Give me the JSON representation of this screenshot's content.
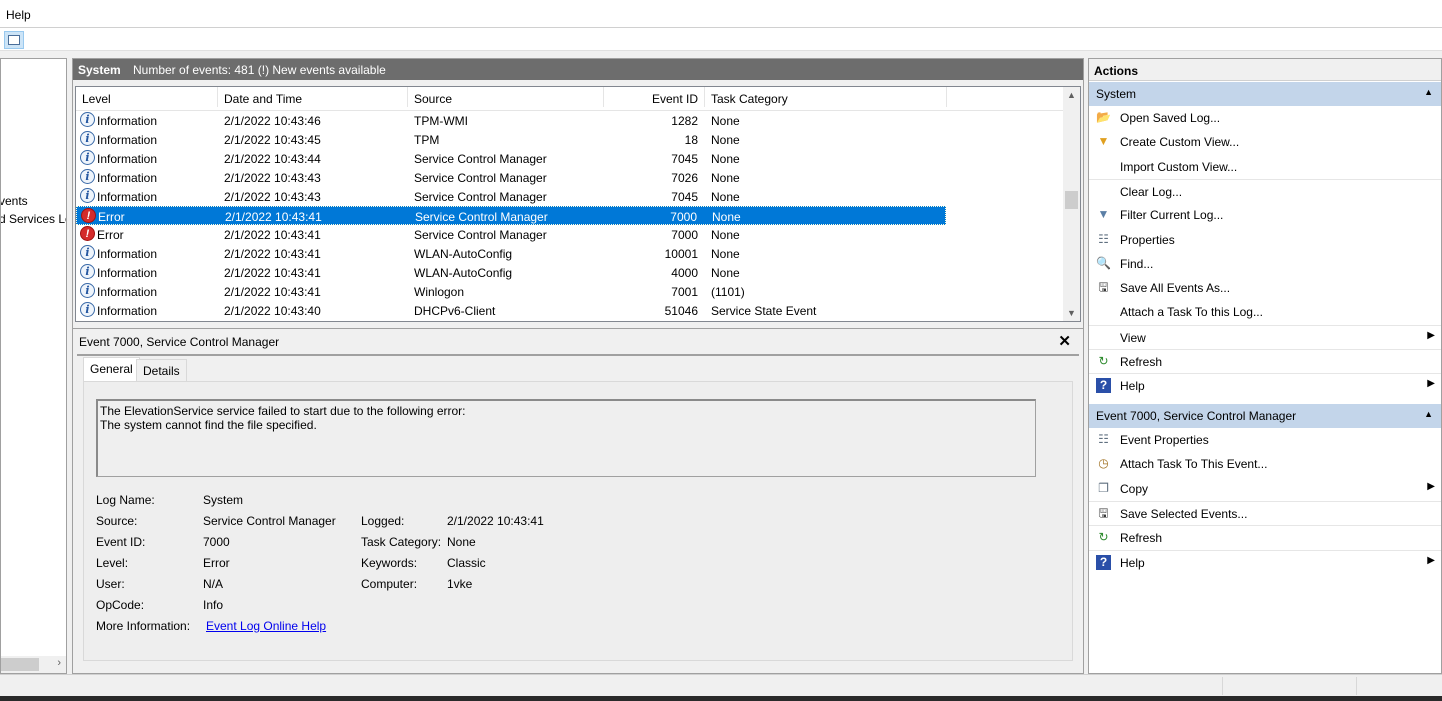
{
  "menu": {
    "items": [
      "Help"
    ]
  },
  "toolbar": {
    "buttons": [
      {
        "icon": "show-hide-console-tree-icon"
      }
    ]
  },
  "tree": {
    "items": [
      "vents",
      "d Services Lo"
    ]
  },
  "log_header": {
    "title": "System",
    "summary": "Number of events: 481 (!) New events available"
  },
  "events": {
    "columns": [
      "Level",
      "Date and Time",
      "Source",
      "Event ID",
      "Task Category"
    ],
    "rows": [
      {
        "level": "Information",
        "icon": "info",
        "date": "2/1/2022 10:43:46",
        "source": "TPM-WMI",
        "id": "1282",
        "cat": "None"
      },
      {
        "level": "Information",
        "icon": "info",
        "date": "2/1/2022 10:43:45",
        "source": "TPM",
        "id": "18",
        "cat": "None"
      },
      {
        "level": "Information",
        "icon": "info",
        "date": "2/1/2022 10:43:44",
        "source": "Service Control Manager",
        "id": "7045",
        "cat": "None"
      },
      {
        "level": "Information",
        "icon": "info",
        "date": "2/1/2022 10:43:43",
        "source": "Service Control Manager",
        "id": "7026",
        "cat": "None"
      },
      {
        "level": "Information",
        "icon": "info",
        "date": "2/1/2022 10:43:43",
        "source": "Service Control Manager",
        "id": "7045",
        "cat": "None"
      },
      {
        "level": "Error",
        "icon": "error",
        "date": "2/1/2022 10:43:41",
        "source": "Service Control Manager",
        "id": "7000",
        "cat": "None",
        "selected": true
      },
      {
        "level": "Error",
        "icon": "error",
        "date": "2/1/2022 10:43:41",
        "source": "Service Control Manager",
        "id": "7000",
        "cat": "None"
      },
      {
        "level": "Information",
        "icon": "info",
        "date": "2/1/2022 10:43:41",
        "source": "WLAN-AutoConfig",
        "id": "10001",
        "cat": "None"
      },
      {
        "level": "Information",
        "icon": "info",
        "date": "2/1/2022 10:43:41",
        "source": "WLAN-AutoConfig",
        "id": "4000",
        "cat": "None"
      },
      {
        "level": "Information",
        "icon": "info",
        "date": "2/1/2022 10:43:41",
        "source": "Winlogon",
        "id": "7001",
        "cat": "(1101)"
      },
      {
        "level": "Information",
        "icon": "info",
        "date": "2/1/2022 10:43:40",
        "source": "DHCPv6-Client",
        "id": "51046",
        "cat": "Service State Event"
      }
    ]
  },
  "detail": {
    "title": "Event 7000, Service Control Manager",
    "tabs": [
      "General",
      "Details"
    ],
    "active_tab": "General",
    "message_line1": "The ElevationService service failed to start due to the following error:",
    "message_line2": "The system cannot find the file specified.",
    "fields": {
      "log_name_label": "Log Name:",
      "log_name": "System",
      "source_label": "Source:",
      "source": "Service Control Manager",
      "logged_label": "Logged:",
      "logged": "2/1/2022 10:43:41",
      "event_id_label": "Event ID:",
      "event_id": "7000",
      "task_label": "Task Category:",
      "task": "None",
      "level_label": "Level:",
      "level": "Error",
      "keywords_label": "Keywords:",
      "keywords": "Classic",
      "user_label": "User:",
      "user": "N/A",
      "computer_label": "Computer:",
      "computer": "1vke",
      "opcode_label": "OpCode:",
      "opcode": "Info",
      "more_label": "More Information:",
      "more_link": "Event Log Online Help"
    }
  },
  "actions": {
    "title": "Actions",
    "section1": {
      "title": "System",
      "items": [
        {
          "label": "Open Saved Log...",
          "icon": "open-folder-icon"
        },
        {
          "label": "Create Custom View...",
          "icon": "filter-create-icon"
        },
        {
          "label": "Import Custom View...",
          "icon": ""
        },
        {
          "label": "Clear Log...",
          "icon": ""
        },
        {
          "label": "Filter Current Log...",
          "icon": "filter-icon"
        },
        {
          "label": "Properties",
          "icon": "properties-icon"
        },
        {
          "label": "Find...",
          "icon": "binoculars-icon"
        },
        {
          "label": "Save All Events As...",
          "icon": "save-icon"
        },
        {
          "label": "Attach a Task To this Log...",
          "icon": ""
        },
        {
          "label": "View",
          "icon": "",
          "submenu": true
        },
        {
          "label": "Refresh",
          "icon": "refresh-icon"
        },
        {
          "label": "Help",
          "icon": "help-icon",
          "submenu": true
        }
      ]
    },
    "section2": {
      "title": "Event 7000, Service Control Manager",
      "items": [
        {
          "label": "Event Properties",
          "icon": "properties-icon"
        },
        {
          "label": "Attach Task To This Event...",
          "icon": "task-clock-icon"
        },
        {
          "label": "Copy",
          "icon": "copy-icon",
          "submenu": true
        },
        {
          "label": "Save Selected Events...",
          "icon": "save-icon"
        },
        {
          "label": "Refresh",
          "icon": "refresh-icon"
        },
        {
          "label": "Help",
          "icon": "help-icon",
          "submenu": true
        }
      ]
    }
  },
  "colors": {
    "selection": "#0078d7",
    "section_header": "#c3d5ea",
    "log_header": "#6d6d6d",
    "link": "#0000ee"
  }
}
